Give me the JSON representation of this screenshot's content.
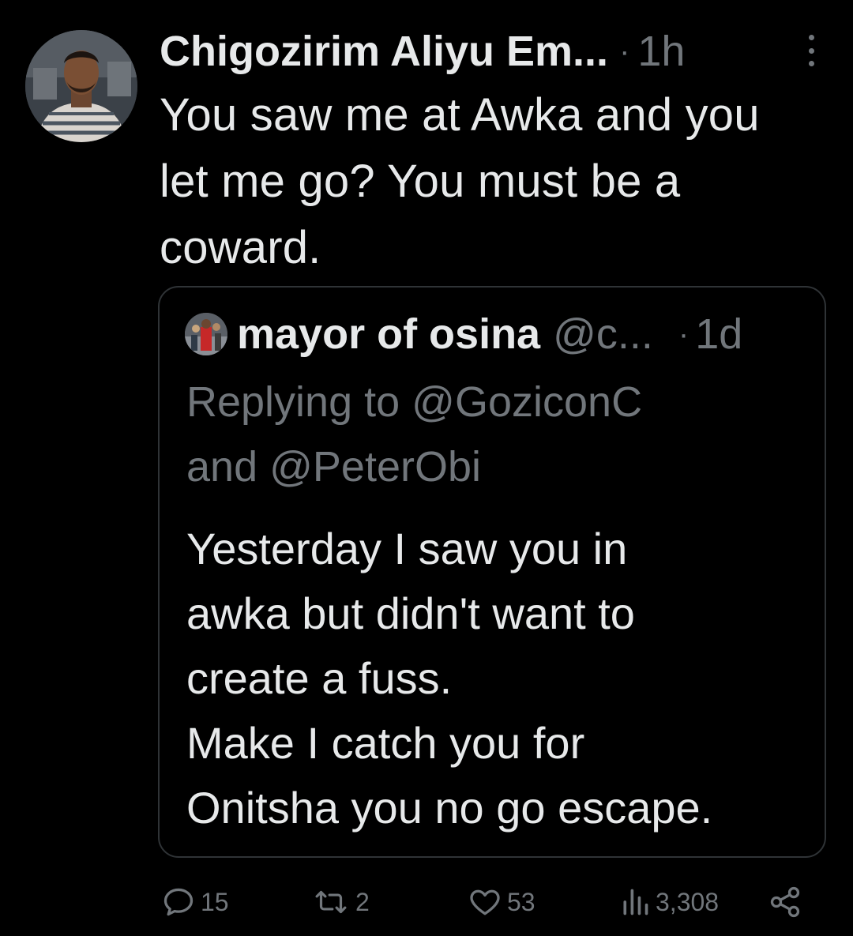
{
  "tweet": {
    "author_name": "Chigozirim Aliyu Em...",
    "separator": "·",
    "time": "1h",
    "text": "You saw me at Awka and you\nlet me go? You must be a\ncoward."
  },
  "quoted_tweet": {
    "author_name": "mayor of osina",
    "handle": "@c...",
    "separator": "·",
    "time": "1d",
    "replying_to": "Replying to @GoziconC\nand @PeterObi",
    "text": "Yesterday I saw you in\nawka but didn't want to\ncreate a fuss.\nMake I catch you for\nOnitsha you no go escape."
  },
  "actions": {
    "reply_count": "15",
    "retweet_count": "2",
    "like_count": "53",
    "view_count": "3,308"
  },
  "icons": {
    "more": "more-vertical-icon",
    "reply": "reply-icon",
    "retweet": "retweet-icon",
    "like": "heart-icon",
    "views": "views-icon",
    "share": "share-icon"
  },
  "colors": {
    "background": "#000000",
    "text_primary": "#e7e9ea",
    "text_secondary": "#71767b",
    "border": "#2f3336"
  }
}
